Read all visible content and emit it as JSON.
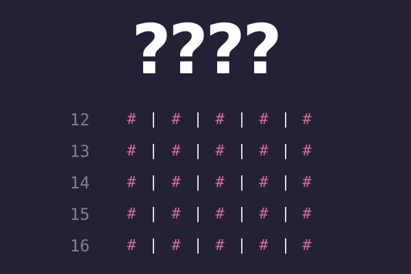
{
  "title": "????",
  "cell_symbol": "#",
  "separator_symbol": "|",
  "rows": [
    {
      "line": "12",
      "cells": [
        "#",
        "#",
        "#",
        "#",
        "#"
      ]
    },
    {
      "line": "13",
      "cells": [
        "#",
        "#",
        "#",
        "#",
        "#"
      ]
    },
    {
      "line": "14",
      "cells": [
        "#",
        "#",
        "#",
        "#",
        "#"
      ]
    },
    {
      "line": "15",
      "cells": [
        "#",
        "#",
        "#",
        "#",
        "#"
      ]
    },
    {
      "line": "16",
      "cells": [
        "#",
        "#",
        "#",
        "#",
        "#"
      ]
    }
  ],
  "colors": {
    "background": "#232136",
    "title": "#ffffff",
    "line_number": "#8e7893",
    "cell": "#d86b8f",
    "separator": "#ecebf3"
  }
}
